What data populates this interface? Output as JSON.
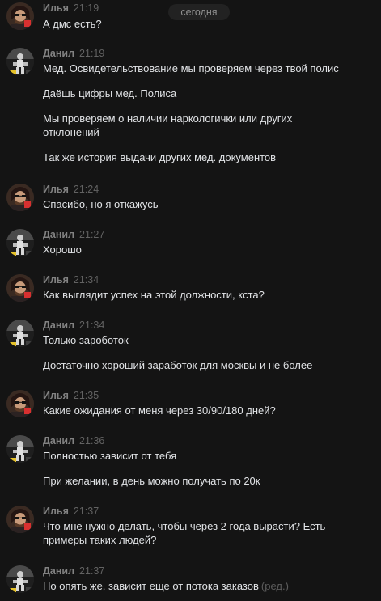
{
  "date_badge": "сегодня",
  "users": {
    "ilya": "Илья",
    "danil": "Данил"
  },
  "edited_label": "(ред.)",
  "messages": [
    {
      "author": "Илья",
      "time": "21:19",
      "lines": [
        "А дмс есть?"
      ]
    },
    {
      "author": "Данил",
      "time": "21:19",
      "lines": [
        "Мед. Освидетельствование мы проверяем через твой полис",
        "Даёшь цифры мед. Полиса",
        "Мы проверяем о наличии наркологички или других",
        "отклонений",
        "Так же история выдачи других мед. документов"
      ]
    },
    {
      "author": "Илья",
      "time": "21:24",
      "lines": [
        "Спасибо, но я откажусь"
      ]
    },
    {
      "author": "Данил",
      "time": "21:27",
      "lines": [
        "Хорошо"
      ]
    },
    {
      "author": "Илья",
      "time": "21:34",
      "lines": [
        "Как выглядит успех на этой должности, кста?"
      ]
    },
    {
      "author": "Данил",
      "time": "21:34",
      "lines": [
        "Только зароботок",
        "Достаточно хороший заработок для москвы и не более"
      ]
    },
    {
      "author": "Илья",
      "time": "21:35",
      "lines": [
        "Какие ожидания от меня через 30/90/180 дней?"
      ]
    },
    {
      "author": "Данил",
      "time": "21:36",
      "lines": [
        "Полностью зависит от тебя",
        "При желании, в день можно получать по 20к"
      ]
    },
    {
      "author": "Илья",
      "time": "21:37",
      "lines": [
        "Что мне нужно делать, чтобы через 2 года вырасти? Есть",
        "примеры таких людей?"
      ]
    },
    {
      "author": "Данил",
      "time": "21:37",
      "lines": [
        "Но опять же, зависит еще от потока заказов"
      ]
    }
  ]
}
